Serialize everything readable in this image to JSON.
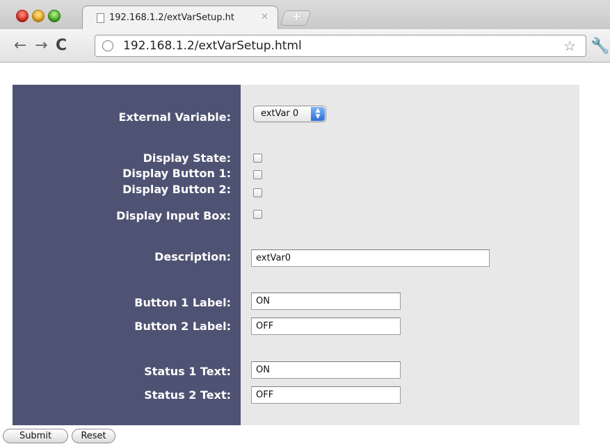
{
  "browser": {
    "tab_title": "192.168.1.2/extVarSetup.ht",
    "tab_close": "✕",
    "new_tab": "+",
    "url": "192.168.1.2/extVarSetup.html",
    "back": "←",
    "forward": "→",
    "reload": "C",
    "star": "☆",
    "wrench": "🔧"
  },
  "form": {
    "labels": {
      "external_variable": "External Variable:",
      "display_state": "Display State:",
      "display_button_1": "Display Button 1:",
      "display_button_2": "Display Button 2:",
      "display_input_box": "Display Input Box:",
      "description": "Description:",
      "button_1_label": "Button 1 Label:",
      "button_2_label": "Button 2 Label:",
      "status_1_text": "Status 1 Text:",
      "status_2_text": "Status 2 Text:"
    },
    "external_variable_selected": "extVar 0",
    "checkboxes": {
      "display_state": false,
      "display_button_1": false,
      "display_button_2": false,
      "display_input_box": false
    },
    "values": {
      "description": "extVar0",
      "button_1_label": "ON",
      "button_2_label": "OFF",
      "status_1_text": "ON",
      "status_2_text": "OFF"
    }
  },
  "buttons": {
    "submit": "Submit",
    "reset": "Reset"
  },
  "colors": {
    "label_column_bg": "#4f5373",
    "field_column_bg": "#e8e8e8"
  }
}
